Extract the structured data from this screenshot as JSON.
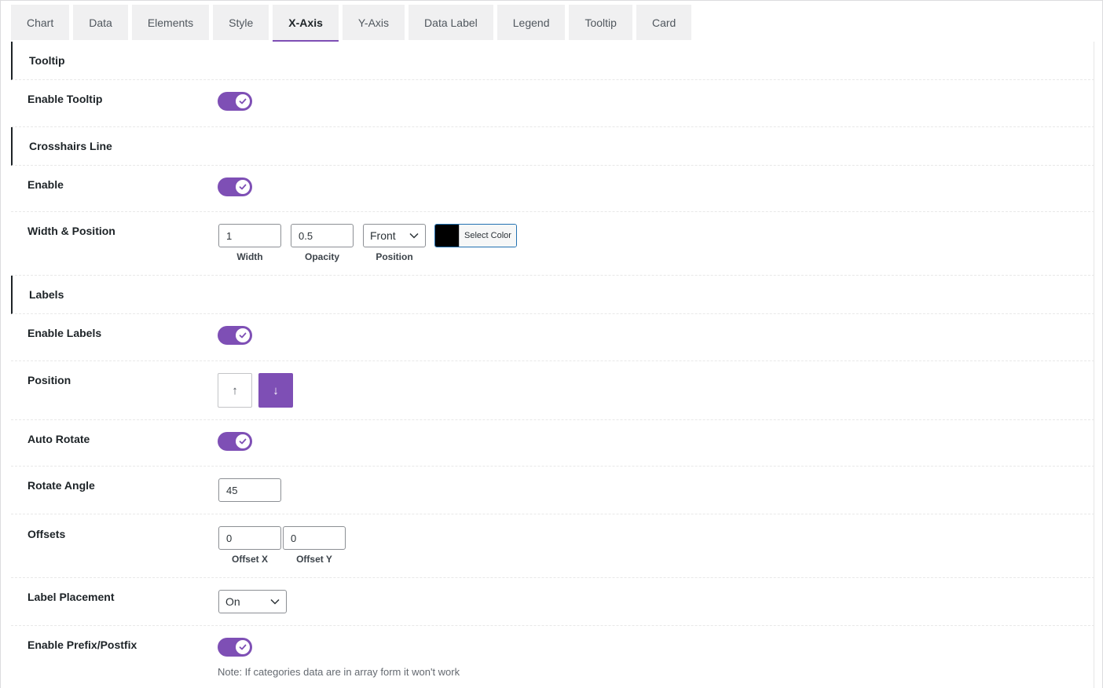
{
  "tabs": [
    "Chart",
    "Data",
    "Elements",
    "Style",
    "X-Axis",
    "Y-Axis",
    "Data Label",
    "Legend",
    "Tooltip",
    "Card"
  ],
  "active_tab": "X-Axis",
  "sections": {
    "tooltip": {
      "title": "Tooltip",
      "enable_label": "Enable Tooltip",
      "enabled": true
    },
    "crosshairs": {
      "title": "Crosshairs Line",
      "enable_label": "Enable",
      "enabled": true,
      "width_position_label": "Width & Position",
      "width_value": "1",
      "width_caption": "Width",
      "opacity_value": "0.5",
      "opacity_caption": "Opacity",
      "position_value": "Front",
      "position_caption": "Position",
      "color_value": "#000000",
      "color_button_label": "Select Color"
    },
    "labels": {
      "title": "Labels",
      "enable_label": "Enable Labels",
      "enabled": true,
      "position_label": "Position",
      "position_up_glyph": "↑",
      "position_down_glyph": "↓",
      "position_selected": "down",
      "auto_rotate_label": "Auto Rotate",
      "auto_rotate": true,
      "rotate_angle_label": "Rotate Angle",
      "rotate_angle_value": "45",
      "offsets_label": "Offsets",
      "offset_x_value": "0",
      "offset_x_caption": "Offset X",
      "offset_y_value": "0",
      "offset_y_caption": "Offset Y",
      "placement_label": "Label Placement",
      "placement_value": "On",
      "prefix_label": "Enable Prefix/Postfix",
      "prefix_enabled": true,
      "prefix_note": "Note: If categories data are in array form it won't work"
    }
  },
  "colors": {
    "accent": "#7e4fb5",
    "focus_border": "#2271b1"
  }
}
